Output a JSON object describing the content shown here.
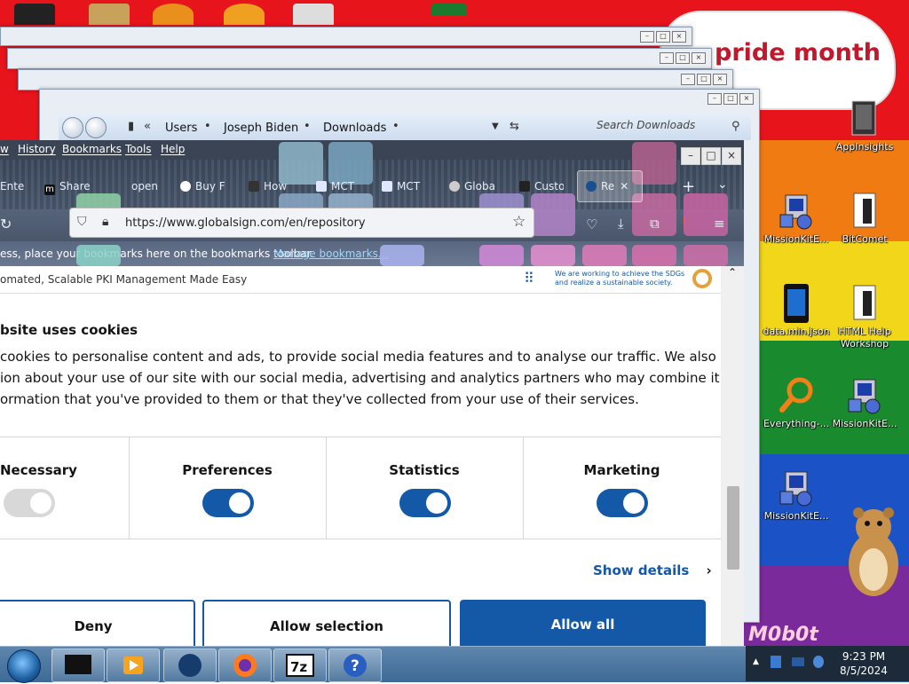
{
  "desktop": {
    "banner_text": "pride month",
    "watermark": "M0b0t",
    "icons": [
      {
        "label": "AppInsights",
        "icon": "appinsights-icon"
      },
      {
        "label": "MissionKitE...",
        "icon": "installer-icon"
      },
      {
        "label": "BitComet",
        "icon": "bitcomet-icon"
      },
      {
        "label": "data.min.json",
        "icon": "json-file-icon"
      },
      {
        "label": "HTML Help Workshop",
        "icon": "html-help-icon"
      },
      {
        "label": "Everything-...",
        "icon": "everything-search-icon"
      },
      {
        "label": "MissionKitE...",
        "icon": "installer-icon"
      },
      {
        "label": "MissionKitE...",
        "icon": "installer-icon"
      }
    ]
  },
  "explorer": {
    "breadcrumbs": [
      "Users",
      "Joseph Biden",
      "Downloads"
    ],
    "search_placeholder": "Search Downloads"
  },
  "browser": {
    "menu": [
      "w",
      "History",
      "Bookmarks",
      "Tools",
      "Help"
    ],
    "tabs": [
      "Ente",
      "Share",
      "open",
      "Buy F",
      "How",
      "MCT",
      "MCT",
      "Globa",
      "Custo",
      "Re"
    ],
    "url": "https://www.globalsign.com/en/repository",
    "bookmarks_hint": "ess, place your bookmarks here on the bookmarks toolbar.",
    "bookmarks_link": "Manage bookmarks..."
  },
  "page": {
    "top_text": "omated, Scalable PKI Management Made Easy",
    "sdg_text_line1": "We are working to achieve the SDGs",
    "sdg_text_line2": "and realize a sustainable society.",
    "cookie_title": "bsite uses cookies",
    "cookie_body_lines": [
      "cookies to personalise content and ads, to provide social media features and to analyse our traffic. We also share",
      "ion about your use of our site with our social media, advertising and analytics partners who may combine it with",
      "ormation that you've provided to them or that they've collected from your use of their services."
    ],
    "categories": [
      {
        "label": "Necessary",
        "enabled": false
      },
      {
        "label": "Preferences",
        "enabled": true
      },
      {
        "label": "Statistics",
        "enabled": true
      },
      {
        "label": "Marketing",
        "enabled": true
      }
    ],
    "show_details": "Show details",
    "buttons": {
      "deny": "Deny",
      "allow_selection": "Allow selection",
      "allow_all": "Allow all"
    },
    "accent_color": "#1458a8"
  },
  "taskbar": {
    "time": "9:23 PM",
    "date": "8/5/2024"
  }
}
